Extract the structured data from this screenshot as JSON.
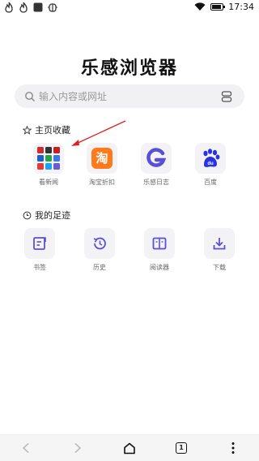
{
  "status_bar": {
    "time": "17:34",
    "left_icons": [
      "flame-app-icon",
      "flame-app-icon",
      "square-app-icon",
      "bug-app-icon"
    ]
  },
  "app_title": "乐感浏览器",
  "search": {
    "placeholder": "输入内容或网址"
  },
  "favorites": {
    "heading": "主页收藏",
    "items": [
      {
        "label": "看新闻",
        "icon": "news-grid-icon"
      },
      {
        "label": "淘宝折扣",
        "icon": "taobao-icon"
      },
      {
        "label": "乐感日志",
        "icon": "g-logo-icon"
      },
      {
        "label": "百度",
        "icon": "baidu-paw-icon"
      }
    ]
  },
  "tracks": {
    "heading": "我的足迹",
    "items": [
      {
        "label": "书签",
        "icon": "bookmark-icon"
      },
      {
        "label": "历史",
        "icon": "history-icon"
      },
      {
        "label": "阅读器",
        "icon": "reader-icon"
      },
      {
        "label": "下载",
        "icon": "download-icon"
      }
    ]
  },
  "bottom_bar": {
    "tab_count": "1",
    "buttons": [
      "back-icon",
      "forward-icon",
      "home-icon",
      "tabs-icon",
      "menu-icon"
    ]
  },
  "colors": {
    "accent_purple": "#5b4fd6",
    "taobao_orange": "#ff7a1a",
    "baidu_blue": "#2932e1",
    "arrow_red": "#e0201e"
  }
}
